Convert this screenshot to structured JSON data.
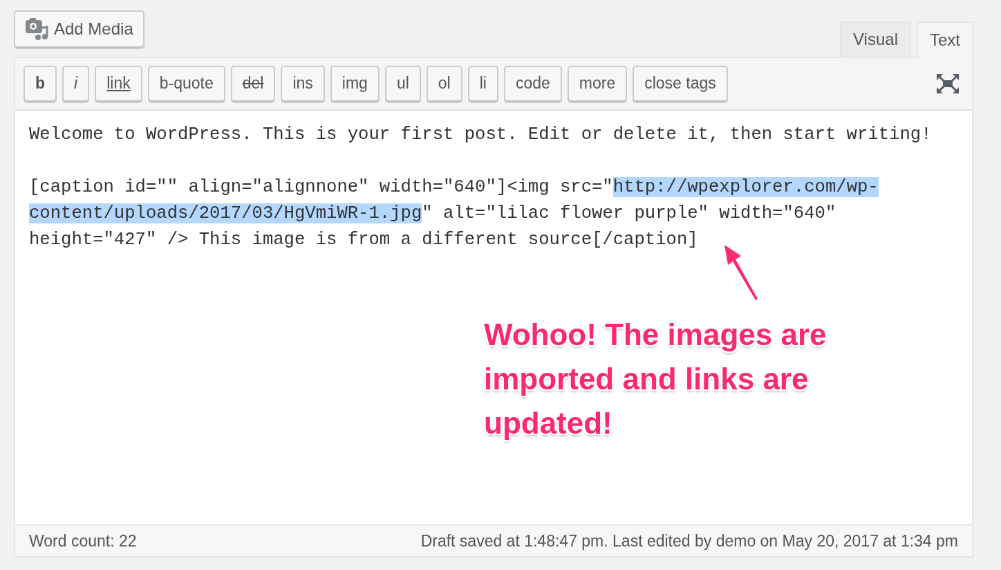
{
  "add_media": {
    "label": "Add Media"
  },
  "tabs": [
    {
      "label": "Visual",
      "selected": false
    },
    {
      "label": "Text",
      "selected": true
    }
  ],
  "toolbar": [
    {
      "label": "b",
      "kind": "bold"
    },
    {
      "label": "i",
      "kind": "italic"
    },
    {
      "label": "link",
      "kind": "underline"
    },
    {
      "label": "b-quote",
      "kind": "plain"
    },
    {
      "label": "del",
      "kind": "strike"
    },
    {
      "label": "ins",
      "kind": "plain"
    },
    {
      "label": "img",
      "kind": "plain"
    },
    {
      "label": "ul",
      "kind": "plain"
    },
    {
      "label": "ol",
      "kind": "plain"
    },
    {
      "label": "li",
      "kind": "plain"
    },
    {
      "label": "code",
      "kind": "plain"
    },
    {
      "label": "more",
      "kind": "plain"
    },
    {
      "label": "close tags",
      "kind": "plain"
    }
  ],
  "content": [
    {
      "segments": [
        {
          "text": "Welcome to WordPress. This is your first post. Edit or delete it, then start writing!",
          "selected": false
        }
      ]
    },
    {
      "segments": [
        {
          "text": "[caption id=\"\" align=\"alignnone\" width=\"640\"]<img src=\"",
          "selected": false
        },
        {
          "text": "http://wpexplorer.com/wp-content/uploads/2017/03/HgVmiWR-1.jpg",
          "selected": true
        },
        {
          "text": "\" alt=\"lilac flower purple\" width=\"640\" height=\"427\" /> This image is from a different source[/caption]",
          "selected": false
        }
      ]
    }
  ],
  "annotation": {
    "text": "Wohoo! The images are imported and links are updated!"
  },
  "status_bar": {
    "word_count": "Word count: 22",
    "saved": "Draft saved at 1:48:47 pm. Last edited by demo on May 20, 2017 at 1:34 pm"
  }
}
